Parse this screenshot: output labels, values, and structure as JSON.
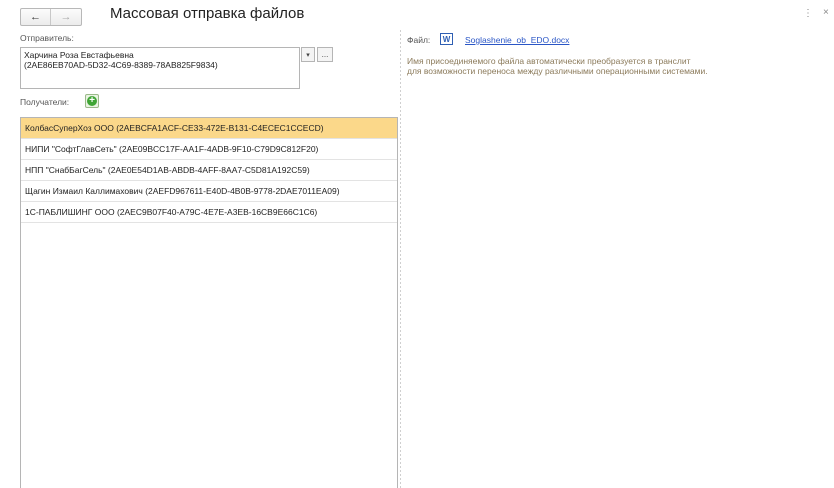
{
  "header": {
    "title": "Массовая отправка файлов",
    "back_icon": "←",
    "forward_icon": "→",
    "menu_icon": "⋮",
    "close_icon": "×"
  },
  "sender": {
    "label": "Отправитель:",
    "name": "Харчина Роза Евстафьевна",
    "id": "(2AE86EB70AD-5D32-4C69-8389-78AB825F9834)",
    "dropdown_icon": "▾",
    "more_label": "..."
  },
  "recipients": {
    "label": "Получатели:",
    "add_icon": "+",
    "items": [
      {
        "text": "КолбасСуперХоз ООО (2AEBCFA1ACF-CE33-472E-B131-C4ECEC1CCECD)",
        "selected": true
      },
      {
        "text": "НИПИ \"СофтГлавСеть\" (2AE09BCC17F-AA1F-4ADB-9F10-C79D9C812F20)",
        "selected": false
      },
      {
        "text": "НПП \"СнабБагСель\" (2AE0E54D1AB-ABDB-4AFF-8AA7-C5D81A192C59)",
        "selected": false
      },
      {
        "text": "Щагин Измаил Каллимахович (2AEFD967611-E40D-4B0B-9778-2DAE7011EA09)",
        "selected": false
      },
      {
        "text": "1С-ПАБЛИШИНГ ООО (2AEC9B07F40-A79C-4E7E-A3EB-16CB9E66C1C6)",
        "selected": false
      }
    ]
  },
  "file": {
    "label": "Файл:",
    "icon_letter": "W",
    "name": "Soglashenie_ob_EDO.docx",
    "note_line1": "Имя присоединяемого файла автоматически преобразуется в транслит",
    "note_line2": "для возможности переноса между различными операционными системами."
  },
  "colors": {
    "selected_row": "#fbd88a",
    "link": "#2a56c6",
    "note": "#8b7a5a",
    "add_green": "#3fa535"
  }
}
